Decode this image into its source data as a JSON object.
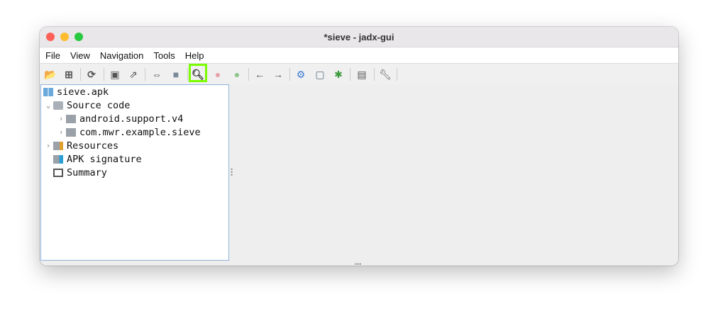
{
  "window": {
    "title": "*sieve - jadx-gui"
  },
  "menu": [
    "File",
    "View",
    "Navigation",
    "Tools",
    "Help"
  ],
  "toolbar": [
    "open-file",
    "add-files",
    "sync",
    "save-all",
    "export",
    "sync-editor",
    "flatten-packages",
    "search",
    "find-usage",
    "find-class",
    "back",
    "forward",
    "deobfuscation",
    "log-viewer",
    "debugger",
    "preferences-log",
    "settings"
  ],
  "tree": {
    "root": "sieve.apk",
    "source_code": "Source code",
    "packages": [
      "android.support.v4",
      "com.mwr.example.sieve"
    ],
    "resources": "Resources",
    "apk_signature": "APK signature",
    "summary": "Summary"
  }
}
